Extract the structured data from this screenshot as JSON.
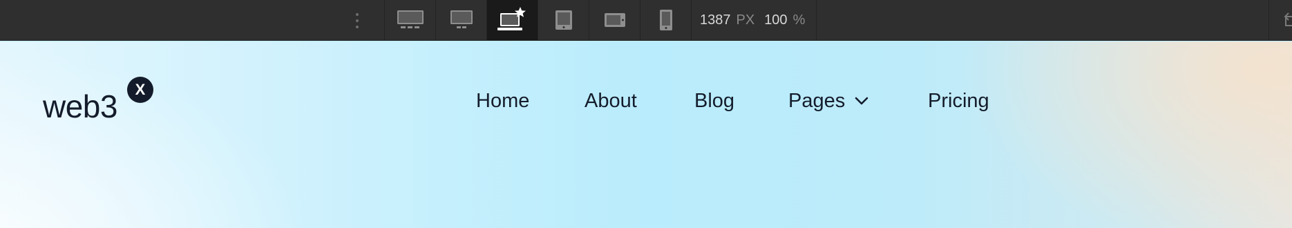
{
  "toolbar": {
    "breakpoints": [
      {
        "name": "desktop-xxl",
        "icon": "monitor-wide-icon"
      },
      {
        "name": "desktop-xl",
        "icon": "monitor-icon"
      },
      {
        "name": "desktop-base",
        "icon": "laptop-star-icon",
        "active": true
      },
      {
        "name": "tablet",
        "icon": "tablet-icon"
      },
      {
        "name": "mobile-landscape",
        "icon": "phone-landscape-icon"
      },
      {
        "name": "mobile-portrait",
        "icon": "phone-portrait-icon"
      }
    ],
    "width_value": "1387",
    "width_unit": "PX",
    "zoom_value": "100",
    "zoom_unit": "%",
    "colors": {
      "background": "#2f2f2f",
      "active": "#1a1a1a",
      "icon": "#8e8e8e",
      "icon_active": "#ffffff"
    }
  },
  "site": {
    "logo_text": "web3",
    "logo_badge": "X",
    "nav": [
      {
        "label": "Home"
      },
      {
        "label": "About"
      },
      {
        "label": "Blog"
      },
      {
        "label": "Pages",
        "has_dropdown": true
      },
      {
        "label": "Pricing"
      }
    ],
    "colors": {
      "text": "#141c2b",
      "bg_primary": "#b9ecfc",
      "bg_accent": "#f4e2ce"
    }
  }
}
